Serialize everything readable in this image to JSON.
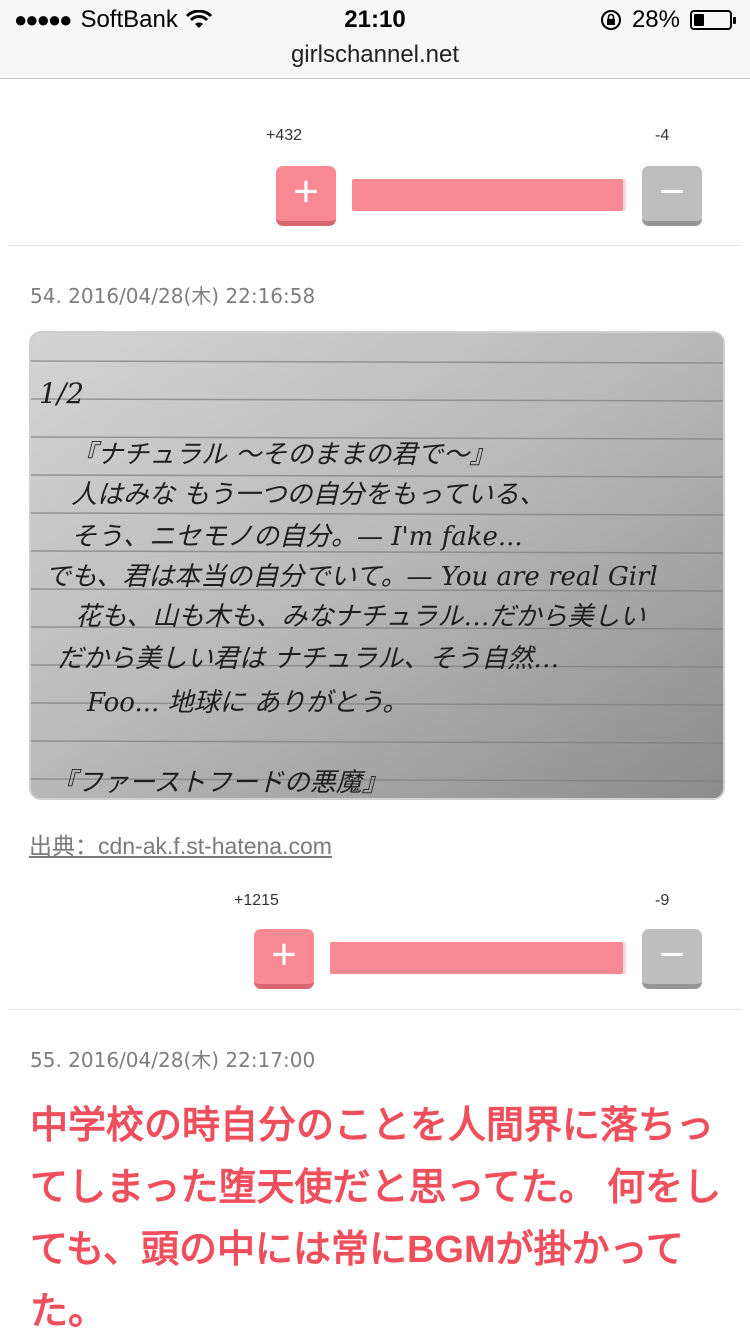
{
  "status_bar": {
    "carrier": "SoftBank",
    "time": "21:10",
    "battery_percent": "28%",
    "battery_level": 0.28
  },
  "url": "girlschannel.net",
  "vote1": {
    "plus": "+432",
    "minus": "-4",
    "plus_symbol": "+",
    "minus_symbol": "−",
    "ratio": 0.99
  },
  "comment54": {
    "meta": "54.  2016/04/28(木) 22:16:58",
    "image_lines": [
      "1/2",
      "『ナチュラル 〜そのままの君で〜』",
      "人はみな もう一つの自分をもっている、",
      "そう、ニセモノの自分。— I'm fake...",
      "でも、君は本当の自分でいて。— You are real Girl",
      "花も、山も木も、みなナチュラル…だから美しい",
      "だから美しい君は ナチュラル、そう自然…",
      "Foo... 地球に ありがとう。",
      "『ファーストフードの悪魔』"
    ],
    "source": "出典：cdn-ak.f.st-hatena.com"
  },
  "vote2": {
    "plus": "+1215",
    "minus": "-9",
    "plus_symbol": "+",
    "minus_symbol": "−",
    "ratio": 0.99
  },
  "comment55": {
    "meta": "55.  2016/04/28(木) 22:17:00",
    "text": "中学校の時自分のことを人間界に落ちってしまった堕天使だと思ってた。 何をしても、頭の中には常にBGMが掛かってた。"
  },
  "colors": {
    "accent": "#ef4f5c",
    "plus_btn": "#f98a93",
    "minus_btn": "#bdbdbd"
  }
}
